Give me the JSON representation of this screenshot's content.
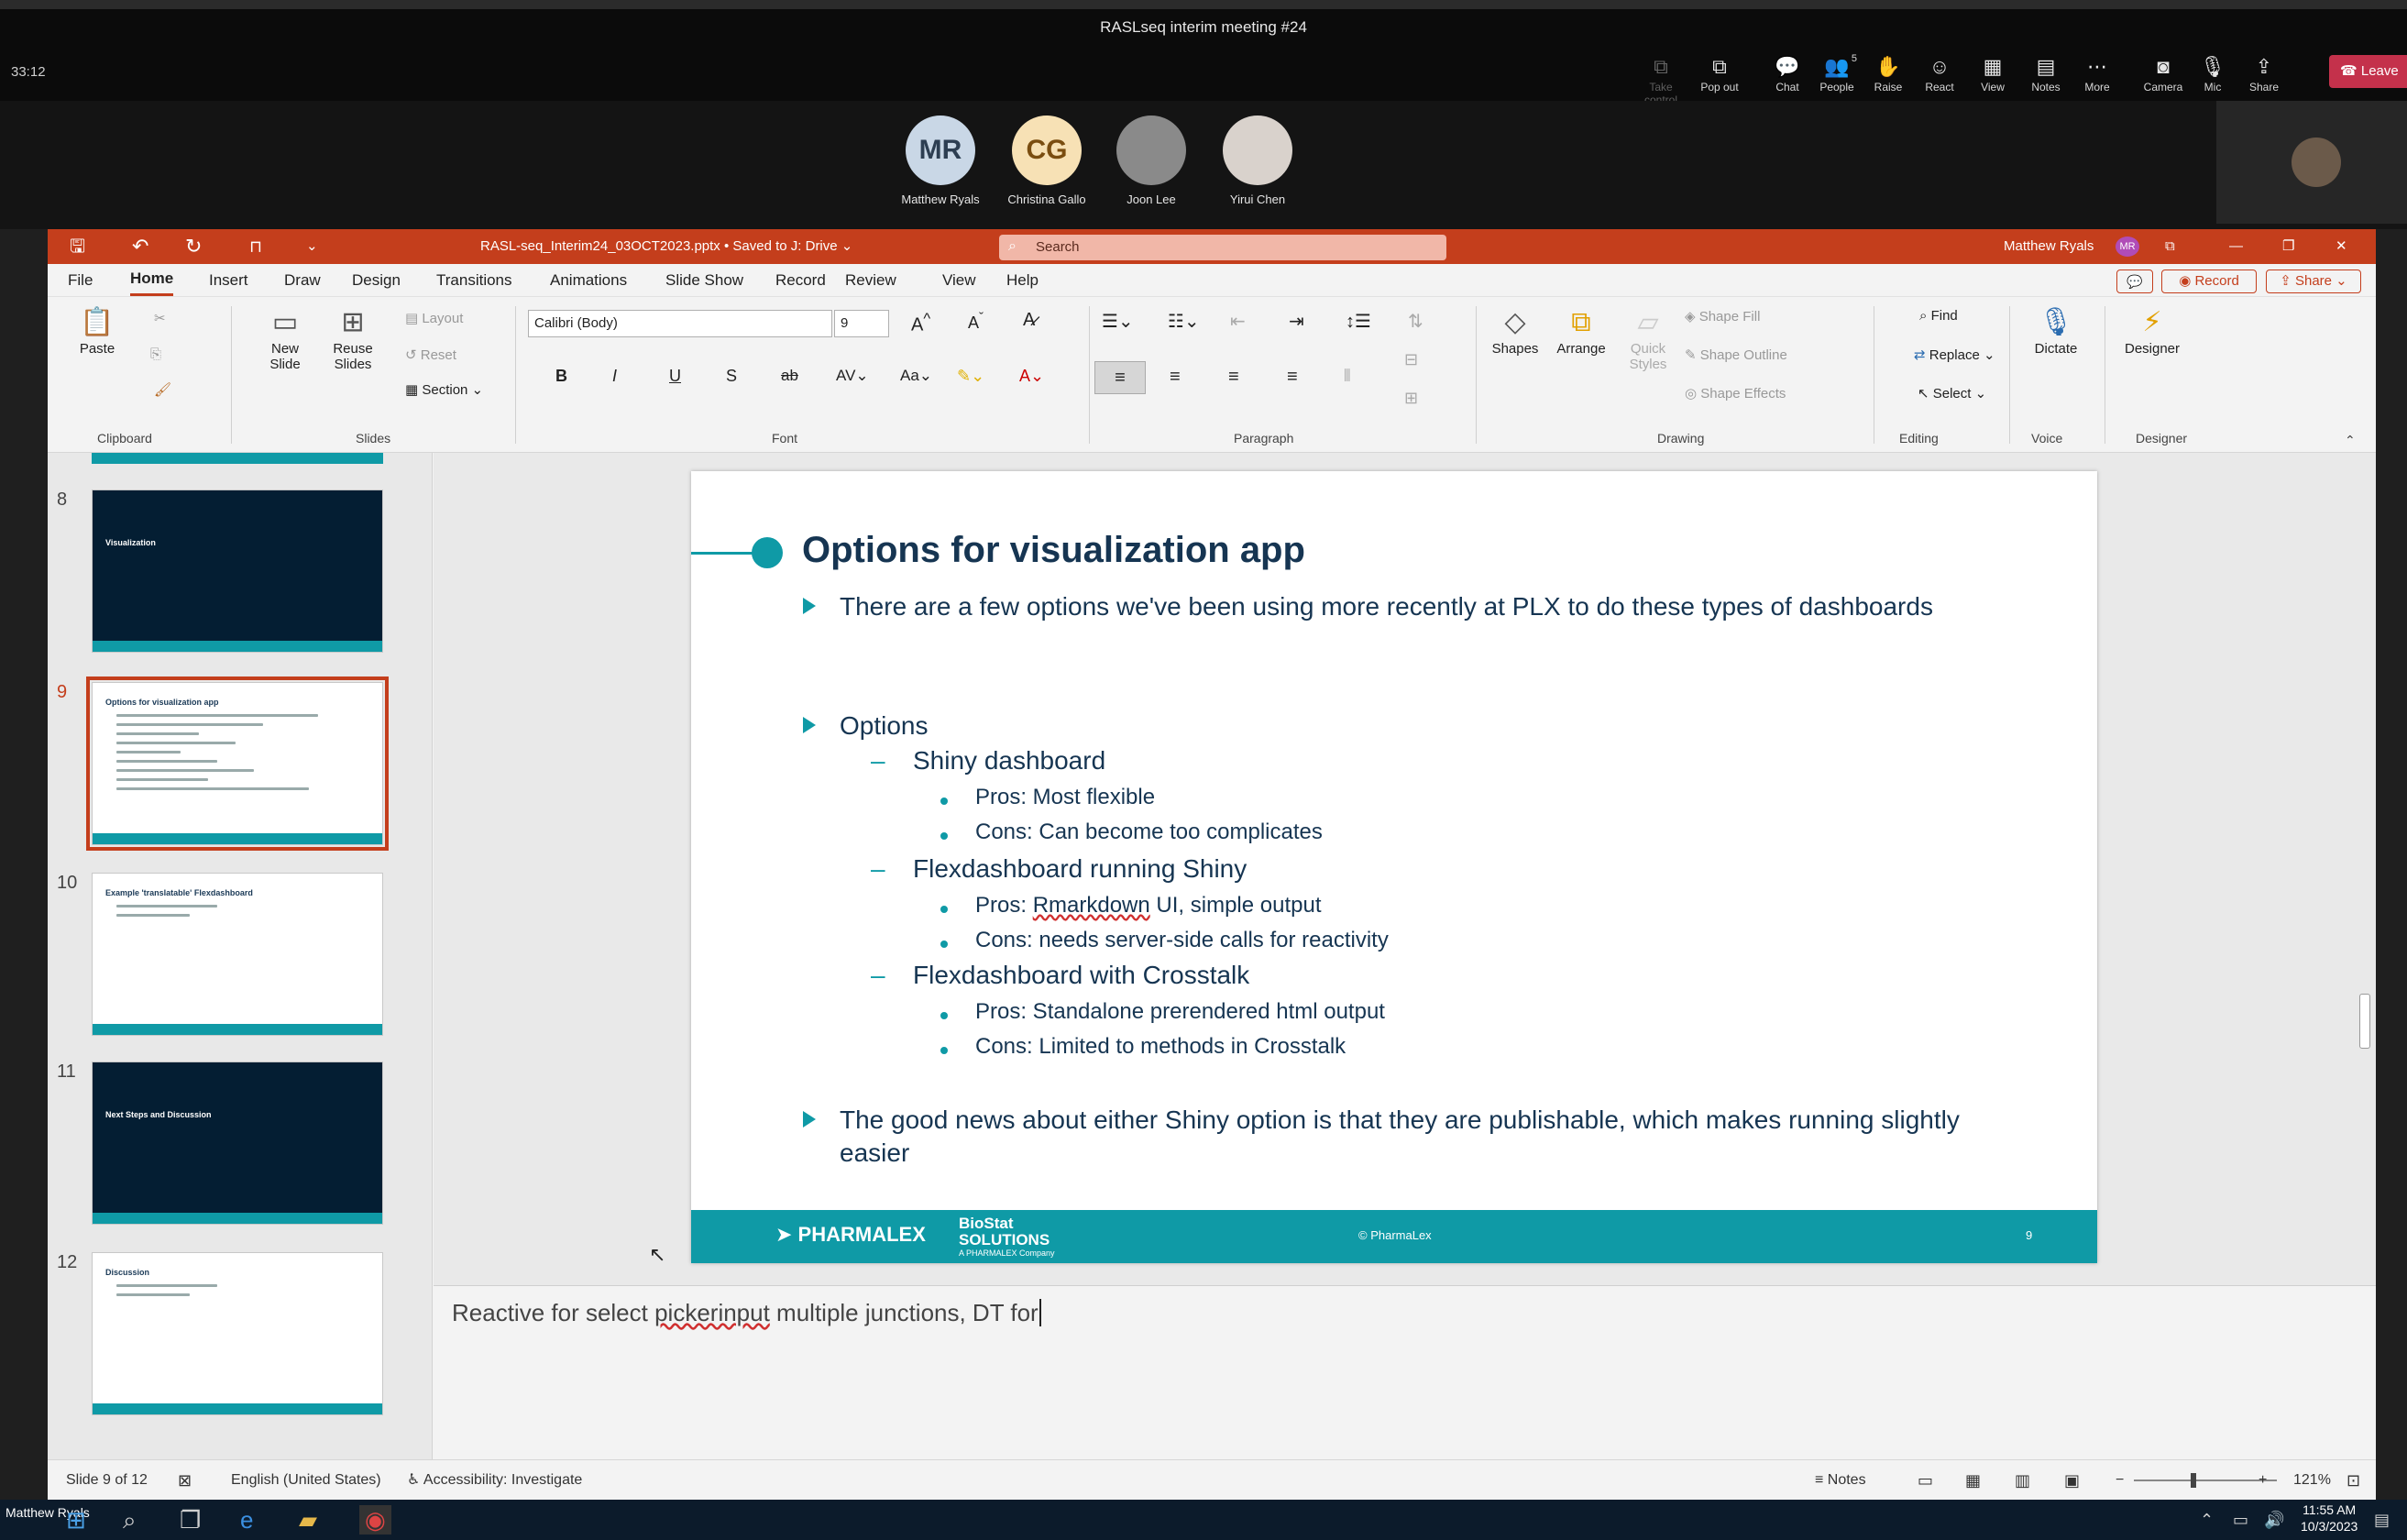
{
  "teams": {
    "title": "RASLseq interim meeting #24",
    "timer": "33:12",
    "toolbar": [
      {
        "label": "Take control",
        "icon": "take-control-icon",
        "glyph": "⧉"
      },
      {
        "label": "Pop out",
        "icon": "pop-out-icon",
        "glyph": "⧉"
      },
      {
        "label": "Chat",
        "icon": "chat-icon",
        "glyph": "💬"
      },
      {
        "label": "People",
        "icon": "people-icon",
        "glyph": "👥",
        "badge": "5"
      },
      {
        "label": "Raise",
        "icon": "raise-hand-icon",
        "glyph": "✋"
      },
      {
        "label": "React",
        "icon": "react-icon",
        "glyph": "☺"
      },
      {
        "label": "View",
        "icon": "view-icon",
        "glyph": "▦"
      },
      {
        "label": "Notes",
        "icon": "notes-icon",
        "glyph": "▤"
      },
      {
        "label": "More",
        "icon": "more-icon",
        "glyph": "⋯"
      },
      {
        "label": "Camera",
        "icon": "camera-off-icon",
        "glyph": "◙"
      },
      {
        "label": "Mic",
        "icon": "mic-off-icon",
        "glyph": "🎙"
      },
      {
        "label": "Share",
        "icon": "share-icon",
        "glyph": "⇪"
      }
    ],
    "leave_label": "Leave",
    "participants": [
      {
        "initials": "MR",
        "name": "Matthew Ryals",
        "bg": "#c9d7e6",
        "fg": "#2d3e52"
      },
      {
        "initials": "CG",
        "name": "Christina Gallo",
        "bg": "#f7e1b5",
        "fg": "#7a4d10"
      },
      {
        "initials": "",
        "name": "Joon Lee",
        "bg": "#8a8a8a",
        "fg": "#fff"
      },
      {
        "initials": "",
        "name": "Yirui Chen",
        "bg": "#d9d2cc",
        "fg": "#fff"
      }
    ]
  },
  "ppt": {
    "filename": "RASL-seq_Interim24_03OCT2023.pptx • Saved to J: Drive ⌄",
    "search_placeholder": "Search",
    "user_name": "Matthew Ryals",
    "user_initials": "MR",
    "menu": [
      "File",
      "Home",
      "Insert",
      "Draw",
      "Design",
      "Transitions",
      "Animations",
      "Slide Show",
      "Record",
      "Review",
      "View",
      "Help"
    ],
    "record_label": "Record",
    "share_label": "Share",
    "ribbon": {
      "paste": "Paste",
      "new_slide": "New Slide",
      "reuse_slides": "Reuse Slides",
      "layout": "Layout",
      "reset": "Reset",
      "section": "Section",
      "font_name": "Calibri (Body)",
      "font_size": "9",
      "shapes": "Shapes",
      "arrange": "Arrange",
      "quick_styles": "Quick Styles",
      "shape_fill": "Shape Fill",
      "shape_outline": "Shape Outline",
      "shape_effects": "Shape Effects",
      "find": "Find",
      "replace": "Replace",
      "select": "Select",
      "dictate": "Dictate",
      "designer": "Designer",
      "groups": [
        "Clipboard",
        "Slides",
        "Font",
        "Paragraph",
        "Drawing",
        "Editing",
        "Voice",
        "Designer"
      ]
    },
    "thumbnails": [
      {
        "num": "8",
        "title": "Visualization",
        "dark": true
      },
      {
        "num": "9",
        "title": "Options for visualization app",
        "dark": false,
        "selected": true
      },
      {
        "num": "10",
        "title": "Example 'translatable' Flexdashboard",
        "dark": false
      },
      {
        "num": "11",
        "title": "Next Steps and Discussion",
        "dark": true
      },
      {
        "num": "12",
        "title": "Discussion",
        "dark": false
      }
    ],
    "slide": {
      "title": "Options for visualization app",
      "bullet1": "There are a few options we've been using more recently at PLX to do these types of dashboards",
      "bullet2": "Options",
      "sub1": "Shiny dashboard",
      "sub1_pros": "Pros: Most flexible",
      "sub1_cons": "Cons: Can become too complicates",
      "sub2": "Flexdashboard running Shiny",
      "sub2_pros_a": "Pros: ",
      "sub2_pros_b": "Rmarkdown",
      "sub2_pros_c": " UI, simple output",
      "sub2_cons": "Cons: needs server-side calls for reactivity",
      "sub3": "Flexdashboard with Crosstalk",
      "sub3_pros": "Pros: Standalone prerendered html output",
      "sub3_cons": "Cons: Limited to methods in Crosstalk",
      "bullet3": "The good news about either Shiny option is that they are publishable, which makes running slightly easier",
      "footer_brand": "PHARMALEX",
      "footer_biostat": "BioStat SOLUTIONS",
      "footer_sub": "A PHARMALEX Company",
      "footer_copyright": "© PharmaLex",
      "footer_page": "9"
    },
    "notes_a": "Reactive for select ",
    "notes_b": "pickerinput",
    "notes_c": " multiple junctions, DT for",
    "status": {
      "slide_of": "Slide 9 of 12",
      "language": "English (United States)",
      "accessibility": "Accessibility: Investigate",
      "notes": "Notes",
      "zoom": "121%"
    }
  },
  "taskbar": {
    "user_label": "Matthew Ryals",
    "time": "11:55 AM",
    "date": "10/3/2023"
  }
}
